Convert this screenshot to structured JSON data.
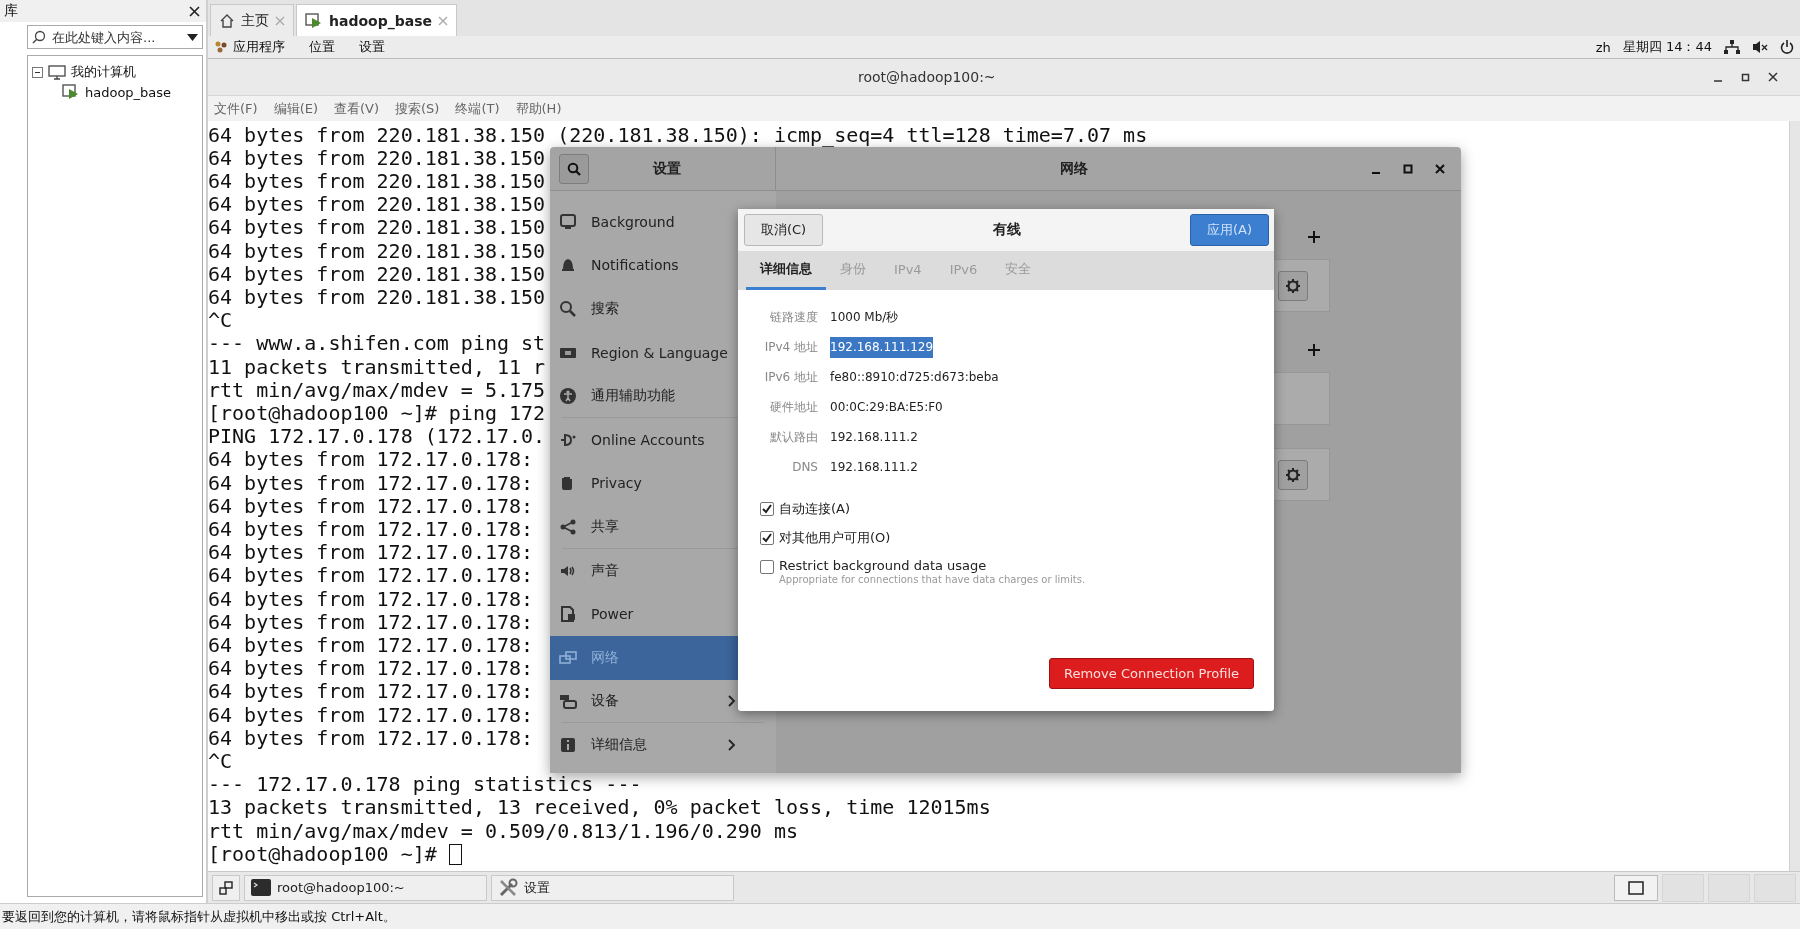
{
  "library": {
    "title": "库",
    "search": {
      "placeholder": "在此处键入内容..."
    },
    "tree": [
      {
        "label": "我的计算机",
        "expanded": true,
        "children": [
          {
            "label": "hadoop_base"
          }
        ]
      }
    ]
  },
  "vm_tabs": [
    {
      "label": "主页",
      "kind": "home",
      "selected": false
    },
    {
      "label": "hadoop_base",
      "kind": "vm",
      "selected": true
    }
  ],
  "top_bar": {
    "menus": [
      "应用程序",
      "位置",
      "设置"
    ],
    "input_method": "zh",
    "clock": "星期四 14：44"
  },
  "terminal": {
    "title": "root@hadoop100:~",
    "menu": [
      "文件(F)",
      "编辑(E)",
      "查看(V)",
      "搜索(S)",
      "终端(T)",
      "帮助(H)"
    ],
    "lines": [
      "64 bytes from 220.181.38.150 (220.181.38.150): icmp_seq=4 ttl=128 time=7.07 ms",
      "64 bytes from 220.181.38.150",
      "64 bytes from 220.181.38.150",
      "64 bytes from 220.181.38.150",
      "64 bytes from 220.181.38.150",
      "64 bytes from 220.181.38.150",
      "64 bytes from 220.181.38.150",
      "64 bytes from 220.181.38.150",
      "^C",
      "--- www.a.shifen.com ping st",
      "11 packets transmitted, 11 r",
      "rtt min/avg/max/mdev = 5.175",
      "[root@hadoop100 ~]# ping 172",
      "PING 172.17.0.178 (172.17.0.",
      "64 bytes from 172.17.0.178:",
      "64 bytes from 172.17.0.178:",
      "64 bytes from 172.17.0.178:",
      "64 bytes from 172.17.0.178:",
      "64 bytes from 172.17.0.178:",
      "64 bytes from 172.17.0.178:",
      "64 bytes from 172.17.0.178:",
      "64 bytes from 172.17.0.178:",
      "64 bytes from 172.17.0.178:",
      "64 bytes from 172.17.0.178:",
      "64 bytes from 172.17.0.178:",
      "64 bytes from 172.17.0.178:",
      "64 bytes from 172.17.0.178:",
      "^C",
      "--- 172.17.0.178 ping statistics ---",
      "13 packets transmitted, 13 received, 0% packet loss, time 12015ms",
      "rtt min/avg/max/mdev = 0.509/0.813/1.196/0.290 ms",
      "[root@hadoop100 ~]#"
    ]
  },
  "settings": {
    "title": "设置",
    "page_title": "网络",
    "sidebar": [
      {
        "label": "Background",
        "kind": "background",
        "selected": false,
        "chevron": false,
        "group_end": false
      },
      {
        "label": "Notifications",
        "kind": "bell",
        "selected": false,
        "chevron": false,
        "group_end": false
      },
      {
        "label": "搜索",
        "kind": "search",
        "selected": false,
        "chevron": false,
        "group_end": false
      },
      {
        "label": "Region & Language",
        "kind": "region",
        "selected": false,
        "chevron": false,
        "group_end": false
      },
      {
        "label": "通用辅助功能",
        "kind": "accessibility",
        "selected": false,
        "chevron": false,
        "group_end": true
      },
      {
        "label": "Online Accounts",
        "kind": "accounts",
        "selected": false,
        "chevron": false,
        "group_end": false
      },
      {
        "label": "Privacy",
        "kind": "privacy",
        "selected": false,
        "chevron": false,
        "group_end": false
      },
      {
        "label": "共享",
        "kind": "share",
        "selected": false,
        "chevron": false,
        "group_end": true
      },
      {
        "label": "声音",
        "kind": "sound",
        "selected": false,
        "chevron": false,
        "group_end": false
      },
      {
        "label": "Power",
        "kind": "power",
        "selected": false,
        "chevron": false,
        "group_end": false
      },
      {
        "label": "网络",
        "kind": "network",
        "selected": true,
        "chevron": false,
        "group_end": false
      },
      {
        "label": "设备",
        "kind": "devices",
        "selected": false,
        "chevron": true,
        "group_end": true
      },
      {
        "label": "详细信息",
        "kind": "info",
        "selected": false,
        "chevron": true,
        "group_end": false
      }
    ],
    "sections": [
      {
        "cards": [
          {
            "gear": true
          }
        ]
      },
      {
        "cards": [
          {
            "gear": false
          },
          {
            "gear": true
          }
        ]
      }
    ]
  },
  "dialog": {
    "cancel": "取消(C)",
    "title": "有线",
    "apply": "应用(A)",
    "tabs": [
      {
        "label": "详细信息",
        "selected": true
      },
      {
        "label": "身份",
        "selected": false
      },
      {
        "label": "IPv4",
        "selected": false
      },
      {
        "label": "IPv6",
        "selected": false
      },
      {
        "label": "安全",
        "selected": false
      }
    ],
    "details": [
      {
        "label": "链路速度",
        "value": "1000 Mb/秒",
        "highlighted": false
      },
      {
        "label": "IPv4 地址",
        "value": "192.168.111.129",
        "highlighted": true
      },
      {
        "label": "IPv6 地址",
        "value": "fe80::8910:d725:d673:beba",
        "highlighted": false
      },
      {
        "label": "硬件地址",
        "value": "00:0C:29:BA:E5:F0",
        "highlighted": false
      },
      {
        "label": "默认路由",
        "value": "192.168.111.2",
        "highlighted": false
      },
      {
        "label": "DNS",
        "value": "192.168.111.2",
        "highlighted": false
      }
    ],
    "options": [
      {
        "label": "自动连接(A)",
        "checked": true
      },
      {
        "label": "对其他用户可用(O)",
        "checked": true
      },
      {
        "label": "Restrict background data usage",
        "hint": "Appropriate for connections that have data charges or limits.",
        "checked": false
      }
    ],
    "remove": "Remove Connection Profile"
  },
  "taskbar": {
    "tasks": [
      {
        "label": "root@hadoop100:~",
        "kind": "terminal"
      },
      {
        "label": "设置",
        "kind": "settings"
      }
    ]
  },
  "status_bar": "要返回到您的计算机，请将鼠标指针从虚拟机中移出或按 Ctrl+Alt。"
}
